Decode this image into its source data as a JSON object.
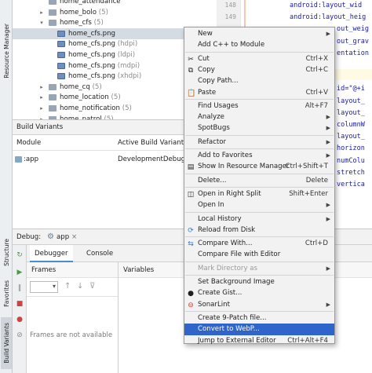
{
  "side_tabs": {
    "resource_manager": "Resource Manager",
    "structure": "Structure",
    "favorites": "Favorites",
    "build_variants": "Build Variants"
  },
  "tree": [
    {
      "label": "home_attendance",
      "suffix": "",
      "kind": "folder",
      "indent": 2,
      "arrow": ""
    },
    {
      "label": "home_bolo",
      "suffix": "(5)",
      "kind": "folder",
      "indent": 2,
      "arrow": "▸"
    },
    {
      "label": "home_cfs",
      "suffix": "(5)",
      "kind": "folder",
      "indent": 2,
      "arrow": "▾"
    },
    {
      "label": "home_cfs.png",
      "suffix": "",
      "kind": "img",
      "indent": 3,
      "arrow": ""
    },
    {
      "label": "home_cfs.png",
      "suffix": "(hdpi)",
      "kind": "img",
      "indent": 3,
      "arrow": ""
    },
    {
      "label": "home_cfs.png",
      "suffix": "(ldpi)",
      "kind": "img",
      "indent": 3,
      "arrow": ""
    },
    {
      "label": "home_cfs.png",
      "suffix": "(mdpi)",
      "kind": "img",
      "indent": 3,
      "arrow": ""
    },
    {
      "label": "home_cfs.png",
      "suffix": "(xhdpi)",
      "kind": "img",
      "indent": 3,
      "arrow": ""
    },
    {
      "label": "home_cq",
      "suffix": "(5)",
      "kind": "folder",
      "indent": 2,
      "arrow": "▸"
    },
    {
      "label": "home_location",
      "suffix": "(5)",
      "kind": "folder",
      "indent": 2,
      "arrow": "▸"
    },
    {
      "label": "home_notification",
      "suffix": "(5)",
      "kind": "folder",
      "indent": 2,
      "arrow": "▸"
    },
    {
      "label": "home_patrol",
      "suffix": "(5)",
      "kind": "folder",
      "indent": 2,
      "arrow": "▸"
    }
  ],
  "gutter": {
    "line1": "148",
    "line2": "149"
  },
  "code_lines": [
    "android:layout_wid",
    "android:layout_heig",
    "out_weig",
    "out_grav",
    "entation",
    "",
    "",
    "id=\"@+i",
    "layout_",
    "layout_",
    "columnW",
    "layout_",
    "horizon",
    "numColu",
    "stretch",
    "vertica"
  ],
  "code_error": "out",
  "build_variants": {
    "title": "Build Variants",
    "col_module": "Module",
    "col_variant": "Active Build Variant",
    "module": ":app",
    "variant": "DevelopmentDebug"
  },
  "debug": {
    "label": "Debug:",
    "config": "app",
    "tab_debugger": "Debugger",
    "tab_console": "Console",
    "frames": "Frames",
    "variables": "Variables",
    "frames_empty": "Frames are not available"
  },
  "menu": [
    {
      "label": "New",
      "shortcut": "",
      "submenu": true,
      "icon": ""
    },
    {
      "label": "Add C++ to Module",
      "shortcut": "",
      "submenu": false,
      "icon": ""
    },
    {
      "sep": true
    },
    {
      "label": "Cut",
      "u": "C",
      "shortcut": "Ctrl+X",
      "icon": "✂",
      "icon_name": "cut-icon"
    },
    {
      "label": "Copy",
      "u": "C",
      "shortcut": "Ctrl+C",
      "icon": "⧉",
      "icon_name": "copy-icon"
    },
    {
      "label": "Copy Path...",
      "shortcut": "",
      "icon": ""
    },
    {
      "label": "Paste",
      "u": "P",
      "shortcut": "Ctrl+V",
      "icon": "📋",
      "icon_name": "paste-icon"
    },
    {
      "sep": true
    },
    {
      "label": "Find Usages",
      "u": "U",
      "shortcut": "Alt+F7",
      "icon": ""
    },
    {
      "label": "Analyze",
      "shortcut": "",
      "submenu": true,
      "icon": ""
    },
    {
      "label": "SpotBugs",
      "shortcut": "",
      "submenu": true,
      "icon": ""
    },
    {
      "sep": true
    },
    {
      "label": "Refactor",
      "u": "R",
      "shortcut": "",
      "submenu": true,
      "icon": ""
    },
    {
      "sep": true
    },
    {
      "label": "Add to Favorites",
      "shortcut": "",
      "submenu": true,
      "icon": ""
    },
    {
      "label": "Show In Resource Manager",
      "shortcut": "Ctrl+Shift+T",
      "icon": "▤",
      "icon_name": "resource-manager-icon"
    },
    {
      "sep": true
    },
    {
      "label": "Delete...",
      "u": "D",
      "shortcut": "Delete",
      "icon": ""
    },
    {
      "sep": true
    },
    {
      "label": "Open in Right Split",
      "shortcut": "Shift+Enter",
      "icon": "◫",
      "icon_name": "split-icon"
    },
    {
      "label": "Open In",
      "shortcut": "",
      "submenu": true,
      "icon": ""
    },
    {
      "sep": true
    },
    {
      "label": "Local History",
      "u": "H",
      "shortcut": "",
      "submenu": true,
      "icon": ""
    },
    {
      "label": "Reload from Disk",
      "shortcut": "",
      "icon": "⟳",
      "icon_name": "reload-icon"
    },
    {
      "sep": true
    },
    {
      "label": "Compare With...",
      "shortcut": "Ctrl+D",
      "icon": "⇆",
      "icon_name": "compare-icon"
    },
    {
      "label": "Compare File with Editor",
      "shortcut": "",
      "icon": ""
    },
    {
      "sep": true
    },
    {
      "label": "Mark Directory as",
      "shortcut": "",
      "submenu": true,
      "icon": "",
      "disabled": true
    },
    {
      "sep": true
    },
    {
      "label": "Set Background Image",
      "shortcut": "",
      "icon": ""
    },
    {
      "label": "Create Gist...",
      "shortcut": "",
      "icon": "●",
      "icon_name": "github-icon"
    },
    {
      "label": "SonarLint",
      "shortcut": "",
      "submenu": true,
      "icon": "⊖",
      "icon_name": "sonarlint-icon"
    },
    {
      "sep": true
    },
    {
      "label": "Create 9-Patch file...",
      "shortcut": "",
      "icon": ""
    },
    {
      "label": "Convert to WebP...",
      "shortcut": "",
      "icon": "",
      "selected": true
    },
    {
      "label": "Jump to External Editor",
      "shortcut": "Ctrl+Alt+F4",
      "icon": ""
    }
  ]
}
